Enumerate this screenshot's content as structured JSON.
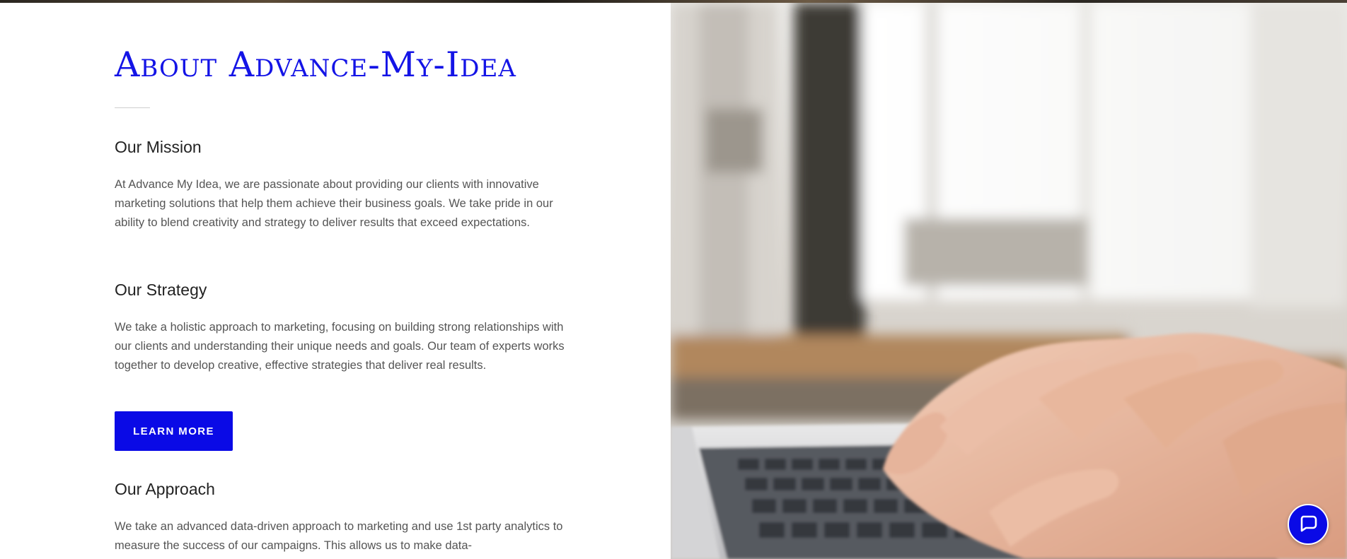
{
  "about": {
    "title": "About Advance-My-Idea"
  },
  "sections": [
    {
      "heading": "Our Mission",
      "body": "At Advance My Idea, we are passionate about providing our clients with innovative marketing solutions that help them achieve their business goals. We take pride in our ability to blend creativity and strategy to deliver results that exceed expectations."
    },
    {
      "heading": "Our Strategy",
      "body": "We take a holistic approach to marketing, focusing on building strong relationships with our clients and understanding their unique needs and goals. Our team of experts works together to develop creative, effective strategies that deliver real results."
    },
    {
      "heading": "Our Approach",
      "body": "We take an advanced data-driven approach to marketing and use 1st party analytics to measure the success of our campaigns. This allows us to make data-"
    }
  ],
  "cta": {
    "learn_more_label": "LEARN MORE"
  },
  "chat": {
    "icon": "chat-bubble-icon"
  },
  "hero": {
    "image": "photo-hands-typing-on-laptop"
  },
  "colors": {
    "accent": "#0a0ae6",
    "heading": "#222222",
    "body_text": "#555555"
  }
}
